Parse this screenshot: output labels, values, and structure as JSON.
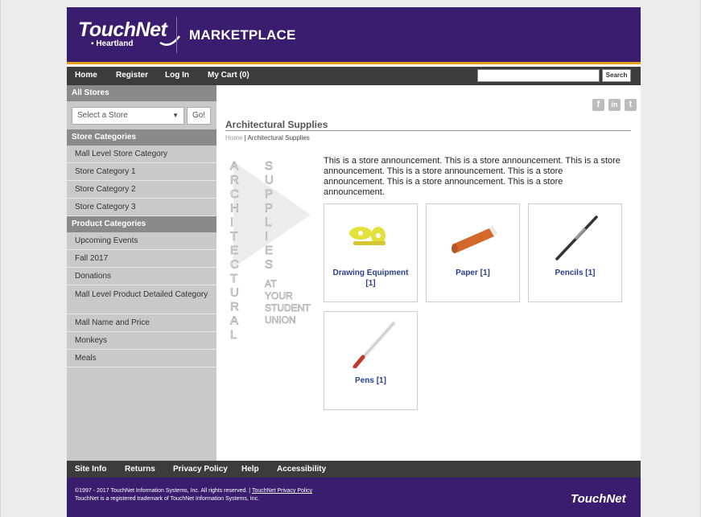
{
  "header": {
    "logo_text": "TouchNet",
    "logo_sub": "Heartland",
    "title": "MARKETPLACE"
  },
  "nav": {
    "items": [
      "Home",
      "Register",
      "Log In",
      "My Cart (0)"
    ],
    "search_placeholder": "",
    "search_label": "Search"
  },
  "sidebar": {
    "all_stores": "All Stores",
    "select_store": "Select a Store",
    "go_label": "Go!",
    "store_categories_head": "Store Categories",
    "store_categories": [
      "Mall Level Store Category",
      "Store Category 1",
      "Store Category 2",
      "Store Category 3"
    ],
    "product_categories_head": "Product Categories",
    "product_categories": [
      "Upcoming Events",
      "Fall 2017",
      "Donations",
      "Mall Level Product Detailed Category",
      "Mall Name and Price",
      "Monkeys",
      "Meals"
    ]
  },
  "content": {
    "social": [
      "f",
      "in",
      "t"
    ],
    "store_title": "Architectural Supplies",
    "breadcrumb_home": "Home",
    "breadcrumb_sep": " | ",
    "breadcrumb_current": "Architectural Supplies",
    "banner": {
      "col1": [
        "A",
        "R",
        "C",
        "H",
        "I",
        "T",
        "E",
        "C",
        "T",
        "U",
        "R",
        "A",
        "L"
      ],
      "col2": [
        "S",
        "U",
        "P",
        "P",
        "L",
        "I",
        "E",
        "S"
      ],
      "tail": [
        "AT",
        "YOUR",
        "STUDENT",
        "UNION"
      ]
    },
    "announcement": "This is a store announcement. This is a store announcement. This is a store announcement. This is a store announcement. This is a store announcement. This is a store announcement. This is a store announcement.",
    "tiles": [
      {
        "label": "Drawing Equipment [1]",
        "icon": "drawing-equipment-icon"
      },
      {
        "label": "Paper [1]",
        "icon": "paper-roll-icon"
      },
      {
        "label": "Pencils [1]",
        "icon": "pencil-icon"
      },
      {
        "label": "Pens [1]",
        "icon": "pen-icon"
      }
    ]
  },
  "footer": {
    "nav": [
      "Site Info",
      "Returns",
      "Privacy Policy",
      "Help",
      "Accessibility"
    ],
    "copyright_line1": "©1997 - 2017 TouchNet Information Systems, Inc. All rights reserved. | ",
    "privacy_link": "TouchNet Privacy Policy",
    "copyright_line2": "TouchNet is a registered trademark of TouchNet Information Systems, Inc.",
    "logo_text": "TouchNet"
  },
  "colors": {
    "header": "#3a1d6e",
    "accent": "#e2a21a",
    "nav": "#3c3c3c",
    "link": "#2a3e8c"
  }
}
